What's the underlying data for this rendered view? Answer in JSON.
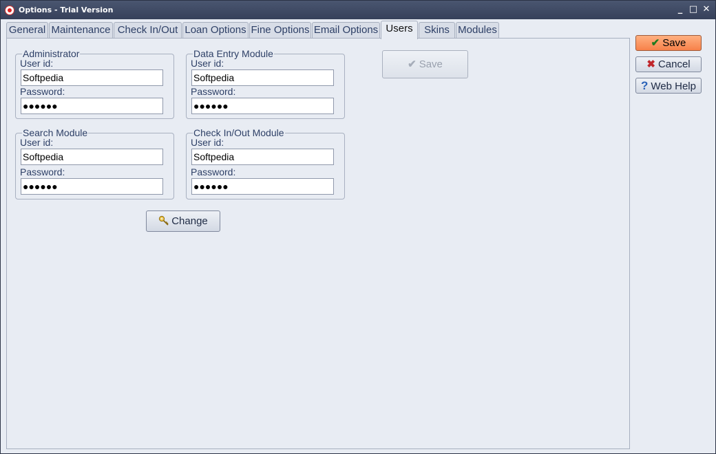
{
  "window": {
    "title": "Options - Trial Version"
  },
  "titlebar_buttons": {
    "minimize": "_",
    "maximize": "□",
    "close": "✕"
  },
  "tabs": [
    {
      "label": "General"
    },
    {
      "label": "Maintenance"
    },
    {
      "label": "Check In/Out"
    },
    {
      "label": "Loan Options"
    },
    {
      "label": "Fine Options"
    },
    {
      "label": "Email Options"
    },
    {
      "label": "Users",
      "active": true
    },
    {
      "label": "Skins"
    },
    {
      "label": "Modules"
    }
  ],
  "groups": {
    "administrator": {
      "title": "Administrator",
      "userid_label": "User id:",
      "userid_value": "Softpedia",
      "password_label": "Password:",
      "password_value": "●●●●●●"
    },
    "data_entry": {
      "title": "Data Entry Module",
      "userid_label": "User id:",
      "userid_value": "Softpedia",
      "password_label": "Password:",
      "password_value": "●●●●●●"
    },
    "search": {
      "title": "Search Module",
      "userid_label": "User id:",
      "userid_value": "Softpedia",
      "password_label": "Password:",
      "password_value": "●●●●●●"
    },
    "checkinout": {
      "title": "Check In/Out Module",
      "userid_label": "User id:",
      "userid_value": "Softpedia",
      "password_label": "Password:",
      "password_value": "●●●●●●"
    }
  },
  "panel_buttons": {
    "save_label": "Save",
    "change_label": "Change"
  },
  "side_buttons": {
    "save_label": "Save",
    "cancel_label": "Cancel",
    "webhelp_label": "Web Help"
  },
  "icons": {
    "check": "✔",
    "cross": "✖",
    "question": "?",
    "key": "key-icon"
  },
  "colors": {
    "accent_save": "#f7814a",
    "title_bar": "#36405a",
    "check_green": "#2e8b2e",
    "cross_red": "#c0262b",
    "help_blue": "#2a62b8"
  }
}
